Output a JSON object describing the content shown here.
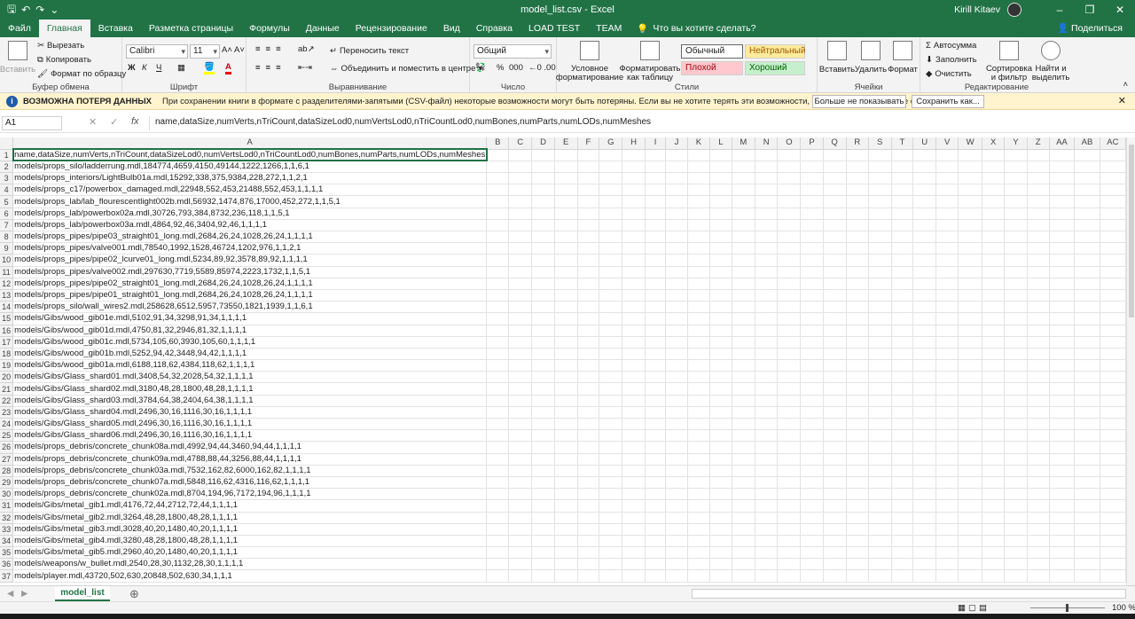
{
  "window": {
    "title": "model_list.csv - Excel",
    "user": "Kirill Kitaev",
    "min": "–",
    "restore": "❐",
    "close": "✕"
  },
  "qat": {
    "save": "🖫",
    "undo": "↶",
    "redo": "↷",
    "customize": "⌄"
  },
  "tabs": [
    "Файл",
    "Главная",
    "Вставка",
    "Разметка страницы",
    "Формулы",
    "Данные",
    "Рецензирование",
    "Вид",
    "Справка",
    "LOAD TEST",
    "TEAM"
  ],
  "tell_me": "Что вы хотите сделать?",
  "share": "Поделиться",
  "ribbon": {
    "clipboard": {
      "paste": "Вставить",
      "cut": "Вырезать",
      "copy": "Копировать",
      "format_painter": "Формат по образцу",
      "label": "Буфер обмена"
    },
    "font": {
      "name": "Calibri",
      "size": "11",
      "bold": "Ж",
      "italic": "К",
      "underline": "Ч",
      "grow": "A˄",
      "shrink": "A˅",
      "label": "Шрифт"
    },
    "alignment": {
      "wrap": "Переносить текст",
      "merge": "Объединить и поместить в центре",
      "label": "Выравнивание"
    },
    "number": {
      "format": "Общий",
      "percent": "%",
      "thousands": "000",
      "label": "Число"
    },
    "styles": {
      "conditional": "Условное форматирование",
      "as_table": "Форматировать как таблицу",
      "normal": "Обычный",
      "neutral": "Нейтральный",
      "bad": "Плохой",
      "good": "Хороший",
      "label": "Стили"
    },
    "cells": {
      "insert": "Вставить",
      "delete": "Удалить",
      "format": "Формат",
      "label": "Ячейки"
    },
    "editing": {
      "autosum": "Автосумма",
      "fill": "Заполнить",
      "clear": "Очистить",
      "sort": "Сортировка и фильтр",
      "find": "Найти и выделить",
      "label": "Редактирование"
    }
  },
  "message_bar": {
    "title": "ВОЗМОЖНА ПОТЕРЯ ДАННЫХ",
    "text": "При сохранении книги в формате с разделителями-запятыми (CSV-файл) некоторые возможности могут быть потеряны. Если вы не хотите терять эти возможности, сохраните ее в формате файла Excel.",
    "btn_dont_show": "Больше не показывать",
    "btn_save_as": "Сохранить как...",
    "close": "✕"
  },
  "formula_bar": {
    "name_box": "A1",
    "cancel": "✕",
    "enter": "✓",
    "fx": "fx",
    "content": "name,dataSize,numVerts,nTriCount,dataSizeLod0,numVertsLod0,nTriCountLod0,numBones,numParts,numLODs,numMeshes"
  },
  "columns": [
    "A",
    "B",
    "C",
    "D",
    "E",
    "F",
    "G",
    "H",
    "I",
    "J",
    "K",
    "L",
    "M",
    "N",
    "O",
    "P",
    "Q",
    "R",
    "S",
    "T",
    "U",
    "V",
    "W",
    "X",
    "Y",
    "Z",
    "AA",
    "AB",
    "AC"
  ],
  "rows": [
    "name,dataSize,numVerts,nTriCount,dataSizeLod0,numVertsLod0,nTriCountLod0,numBones,numParts,numLODs,numMeshes",
    "models/props_silo/ladderrung.mdl,184774,4659,4150,49144,1222,1266,1,1,6,1",
    "models/props_interiors/LightBulb01a.mdl,15292,338,375,9384,228,272,1,1,2,1",
    "models/props_c17/powerbox_damaged.mdl,22948,552,453,21488,552,453,1,1,1,1",
    "models/props_lab/lab_flourescentlight002b.mdl,56932,1474,876,17000,452,272,1,1,5,1",
    "models/props_lab/powerbox02a.mdl,30726,793,384,8732,236,118,1,1,5,1",
    "models/props_lab/powerbox03a.mdl,4864,92,46,3404,92,46,1,1,1,1",
    "models/props_pipes/pipe03_straight01_long.mdl,2684,26,24,1028,26,24,1,1,1,1",
    "models/props_pipes/valve001.mdl,78540,1992,1528,46724,1202,976,1,1,2,1",
    "models/props_pipes/pipe02_lcurve01_long.mdl,5234,89,92,3578,89,92,1,1,1,1",
    "models/props_pipes/valve002.mdl,297630,7719,5589,85974,2223,1732,1,1,5,1",
    "models/props_pipes/pipe02_straight01_long.mdl,2684,26,24,1028,26,24,1,1,1,1",
    "models/props_pipes/pipe01_straight01_long.mdl,2684,26,24,1028,26,24,1,1,1,1",
    "models/props_silo/wall_wires2.mdl,258628,6512,5957,73550,1821,1939,1,1,6,1",
    "models/Gibs/wood_gib01e.mdl,5102,91,34,3298,91,34,1,1,1,1",
    "models/Gibs/wood_gib01d.mdl,4750,81,32,2946,81,32,1,1,1,1",
    "models/Gibs/wood_gib01c.mdl,5734,105,60,3930,105,60,1,1,1,1",
    "models/Gibs/wood_gib01b.mdl,5252,94,42,3448,94,42,1,1,1,1",
    "models/Gibs/wood_gib01a.mdl,6188,118,62,4384,118,62,1,1,1,1",
    "models/Gibs/Glass_shard01.mdl,3408,54,32,2028,54,32,1,1,1,1",
    "models/Gibs/Glass_shard02.mdl,3180,48,28,1800,48,28,1,1,1,1",
    "models/Gibs/Glass_shard03.mdl,3784,64,38,2404,64,38,1,1,1,1",
    "models/Gibs/Glass_shard04.mdl,2496,30,16,1116,30,16,1,1,1,1",
    "models/Gibs/Glass_shard05.mdl,2496,30,16,1116,30,16,1,1,1,1",
    "models/Gibs/Glass_shard06.mdl,2496,30,16,1116,30,16,1,1,1,1",
    "models/props_debris/concrete_chunk08a.mdl,4992,94,44,3460,94,44,1,1,1,1",
    "models/props_debris/concrete_chunk09a.mdl,4788,88,44,3256,88,44,1,1,1,1",
    "models/props_debris/concrete_chunk03a.mdl,7532,162,82,6000,162,82,1,1,1,1",
    "models/props_debris/concrete_chunk07a.mdl,5848,116,62,4316,116,62,1,1,1,1",
    "models/props_debris/concrete_chunk02a.mdl,8704,194,96,7172,194,96,1,1,1,1",
    "models/Gibs/metal_gib1.mdl,4176,72,44,2712,72,44,1,1,1,1",
    "models/Gibs/metal_gib2.mdl,3264,48,28,1800,48,28,1,1,1,1",
    "models/Gibs/metal_gib3.mdl,3028,40,20,1480,40,20,1,1,1,1",
    "models/Gibs/metal_gib4.mdl,3280,48,28,1800,48,28,1,1,1,1",
    "models/Gibs/metal_gib5.mdl,2960,40,20,1480,40,20,1,1,1,1",
    "models/weapons/w_bullet.mdl,2540,28,30,1132,28,30,1,1,1,1",
    "models/player.mdl,43720,502,630,20848,502,630,34,1,1,1"
  ],
  "sheet_tab": "model_list",
  "add_sheet": "⊕",
  "zoom": "100 %",
  "colors": {
    "excel_green": "#217346",
    "message_bg": "#fff4ce",
    "bad_fill": "#ffc7ce",
    "neutral_fill": "#ffeb9c",
    "good_fill": "#c6efce"
  }
}
